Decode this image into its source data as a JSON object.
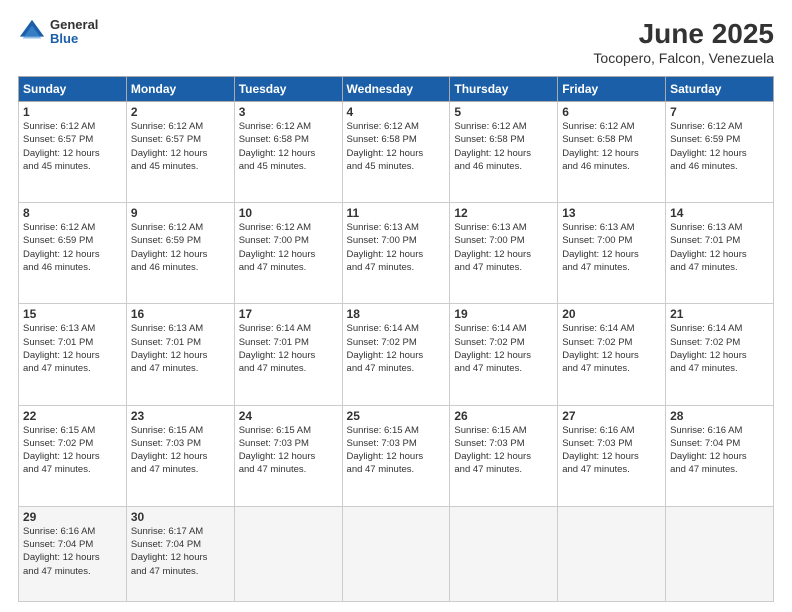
{
  "logo": {
    "general": "General",
    "blue": "Blue"
  },
  "title": "June 2025",
  "subtitle": "Tocopero, Falcon, Venezuela",
  "days_of_week": [
    "Sunday",
    "Monday",
    "Tuesday",
    "Wednesday",
    "Thursday",
    "Friday",
    "Saturday"
  ],
  "weeks": [
    [
      {
        "day": "1",
        "info": "Sunrise: 6:12 AM\nSunset: 6:57 PM\nDaylight: 12 hours\nand 45 minutes."
      },
      {
        "day": "2",
        "info": "Sunrise: 6:12 AM\nSunset: 6:57 PM\nDaylight: 12 hours\nand 45 minutes."
      },
      {
        "day": "3",
        "info": "Sunrise: 6:12 AM\nSunset: 6:58 PM\nDaylight: 12 hours\nand 45 minutes."
      },
      {
        "day": "4",
        "info": "Sunrise: 6:12 AM\nSunset: 6:58 PM\nDaylight: 12 hours\nand 45 minutes."
      },
      {
        "day": "5",
        "info": "Sunrise: 6:12 AM\nSunset: 6:58 PM\nDaylight: 12 hours\nand 46 minutes."
      },
      {
        "day": "6",
        "info": "Sunrise: 6:12 AM\nSunset: 6:58 PM\nDaylight: 12 hours\nand 46 minutes."
      },
      {
        "day": "7",
        "info": "Sunrise: 6:12 AM\nSunset: 6:59 PM\nDaylight: 12 hours\nand 46 minutes."
      }
    ],
    [
      {
        "day": "8",
        "info": "Sunrise: 6:12 AM\nSunset: 6:59 PM\nDaylight: 12 hours\nand 46 minutes."
      },
      {
        "day": "9",
        "info": "Sunrise: 6:12 AM\nSunset: 6:59 PM\nDaylight: 12 hours\nand 46 minutes."
      },
      {
        "day": "10",
        "info": "Sunrise: 6:12 AM\nSunset: 7:00 PM\nDaylight: 12 hours\nand 47 minutes."
      },
      {
        "day": "11",
        "info": "Sunrise: 6:13 AM\nSunset: 7:00 PM\nDaylight: 12 hours\nand 47 minutes."
      },
      {
        "day": "12",
        "info": "Sunrise: 6:13 AM\nSunset: 7:00 PM\nDaylight: 12 hours\nand 47 minutes."
      },
      {
        "day": "13",
        "info": "Sunrise: 6:13 AM\nSunset: 7:00 PM\nDaylight: 12 hours\nand 47 minutes."
      },
      {
        "day": "14",
        "info": "Sunrise: 6:13 AM\nSunset: 7:01 PM\nDaylight: 12 hours\nand 47 minutes."
      }
    ],
    [
      {
        "day": "15",
        "info": "Sunrise: 6:13 AM\nSunset: 7:01 PM\nDaylight: 12 hours\nand 47 minutes."
      },
      {
        "day": "16",
        "info": "Sunrise: 6:13 AM\nSunset: 7:01 PM\nDaylight: 12 hours\nand 47 minutes."
      },
      {
        "day": "17",
        "info": "Sunrise: 6:14 AM\nSunset: 7:01 PM\nDaylight: 12 hours\nand 47 minutes."
      },
      {
        "day": "18",
        "info": "Sunrise: 6:14 AM\nSunset: 7:02 PM\nDaylight: 12 hours\nand 47 minutes."
      },
      {
        "day": "19",
        "info": "Sunrise: 6:14 AM\nSunset: 7:02 PM\nDaylight: 12 hours\nand 47 minutes."
      },
      {
        "day": "20",
        "info": "Sunrise: 6:14 AM\nSunset: 7:02 PM\nDaylight: 12 hours\nand 47 minutes."
      },
      {
        "day": "21",
        "info": "Sunrise: 6:14 AM\nSunset: 7:02 PM\nDaylight: 12 hours\nand 47 minutes."
      }
    ],
    [
      {
        "day": "22",
        "info": "Sunrise: 6:15 AM\nSunset: 7:02 PM\nDaylight: 12 hours\nand 47 minutes."
      },
      {
        "day": "23",
        "info": "Sunrise: 6:15 AM\nSunset: 7:03 PM\nDaylight: 12 hours\nand 47 minutes."
      },
      {
        "day": "24",
        "info": "Sunrise: 6:15 AM\nSunset: 7:03 PM\nDaylight: 12 hours\nand 47 minutes."
      },
      {
        "day": "25",
        "info": "Sunrise: 6:15 AM\nSunset: 7:03 PM\nDaylight: 12 hours\nand 47 minutes."
      },
      {
        "day": "26",
        "info": "Sunrise: 6:15 AM\nSunset: 7:03 PM\nDaylight: 12 hours\nand 47 minutes."
      },
      {
        "day": "27",
        "info": "Sunrise: 6:16 AM\nSunset: 7:03 PM\nDaylight: 12 hours\nand 47 minutes."
      },
      {
        "day": "28",
        "info": "Sunrise: 6:16 AM\nSunset: 7:04 PM\nDaylight: 12 hours\nand 47 minutes."
      }
    ],
    [
      {
        "day": "29",
        "info": "Sunrise: 6:16 AM\nSunset: 7:04 PM\nDaylight: 12 hours\nand 47 minutes."
      },
      {
        "day": "30",
        "info": "Sunrise: 6:17 AM\nSunset: 7:04 PM\nDaylight: 12 hours\nand 47 minutes."
      },
      {
        "day": "",
        "info": ""
      },
      {
        "day": "",
        "info": ""
      },
      {
        "day": "",
        "info": ""
      },
      {
        "day": "",
        "info": ""
      },
      {
        "day": "",
        "info": ""
      }
    ]
  ]
}
